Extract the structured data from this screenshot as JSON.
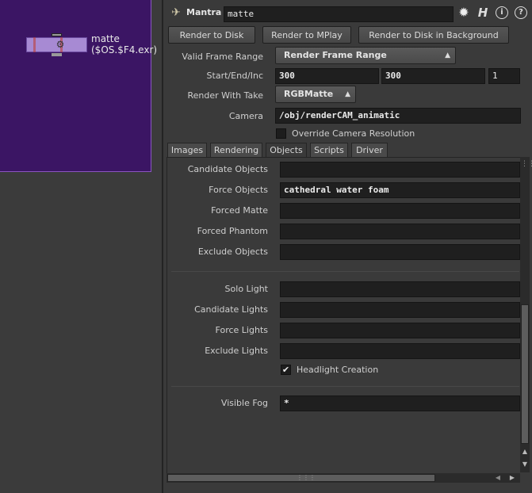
{
  "network": {
    "node_name": "matte",
    "node_output": "($OS.$F4.exr)"
  },
  "header": {
    "node_type": "Mantra",
    "node_name_value": "matte"
  },
  "buttons": {
    "render_disk": "Render to Disk",
    "render_mplay": "Render to MPlay",
    "render_bg": "Render to Disk in Background"
  },
  "params": {
    "valid_range_label": "Valid Frame Range",
    "valid_range_value": "Render Frame Range",
    "sei_label": "Start/End/Inc",
    "start": "300",
    "end": "300",
    "inc": "1",
    "take_label": "Render With Take",
    "take_value": "RGBMatte",
    "camera_label": "Camera",
    "camera_value": "/obj/renderCAM_animatic",
    "override_label": "Override Camera Resolution"
  },
  "tabs": [
    "Images",
    "Rendering",
    "Objects",
    "Scripts",
    "Driver"
  ],
  "objects": {
    "candidate_objects_label": "Candidate Objects",
    "candidate_objects_value": "",
    "force_objects_label": "Force Objects",
    "force_objects_value": "cathedral water foam",
    "forced_matte_label": "Forced Matte",
    "forced_matte_value": "",
    "forced_phantom_label": "Forced Phantom",
    "forced_phantom_value": "",
    "exclude_objects_label": "Exclude Objects",
    "exclude_objects_value": "",
    "solo_light_label": "Solo Light",
    "solo_light_value": "",
    "candidate_lights_label": "Candidate Lights",
    "candidate_lights_value": "",
    "force_lights_label": "Force Lights",
    "force_lights_value": "",
    "exclude_lights_label": "Exclude Lights",
    "exclude_lights_value": "",
    "headlight_label": "Headlight Creation",
    "visible_fog_label": "Visible Fog",
    "visible_fog_value": "*"
  },
  "icons": {
    "gear": "✹",
    "houdini": "H",
    "info": "i",
    "help": "?",
    "check": "✔"
  }
}
